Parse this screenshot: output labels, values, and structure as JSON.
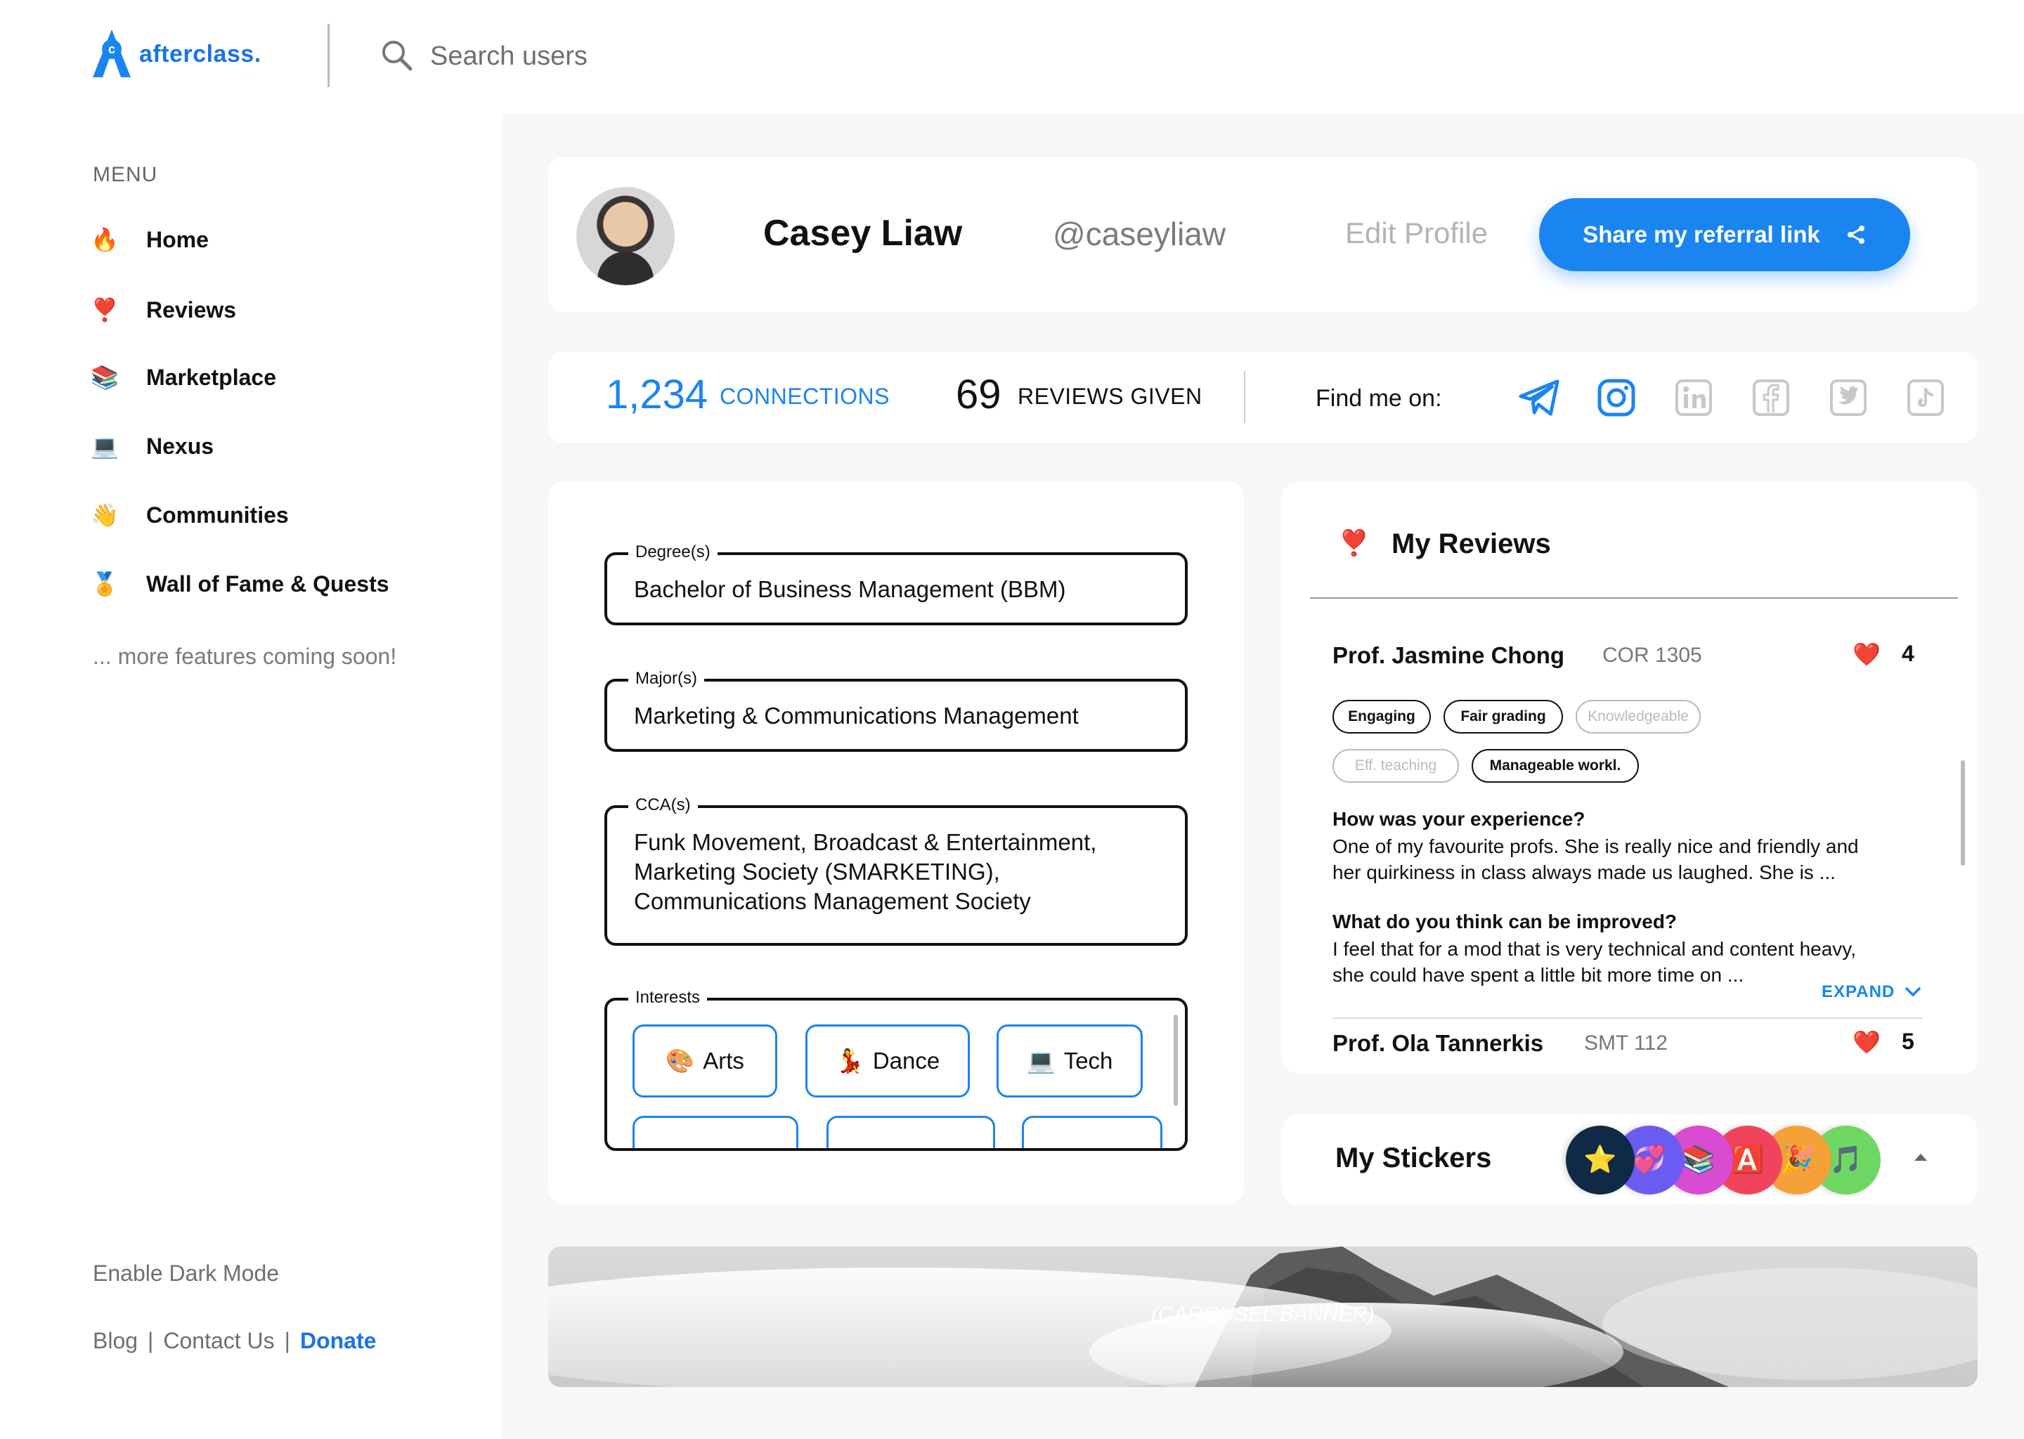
{
  "app": {
    "logo_text": "afterclass",
    "logo_dot": "."
  },
  "search": {
    "placeholder": "Search users"
  },
  "sidebar": {
    "menu_label": "MENU",
    "items": [
      {
        "emoji": "🔥",
        "label": "Home"
      },
      {
        "emoji": "❣️",
        "label": "Reviews"
      },
      {
        "emoji": "📚",
        "label": "Marketplace"
      },
      {
        "emoji": "💻",
        "label": "Nexus"
      },
      {
        "emoji": "👋",
        "label": "Communities"
      },
      {
        "emoji": "🏅",
        "label": "Wall of Fame & Quests"
      }
    ],
    "more_soon": "... more features coming soon!",
    "dark_mode": "Enable Dark Mode",
    "footer": {
      "blog": "Blog",
      "contact": "Contact Us",
      "donate": "Donate",
      "separator": "|"
    }
  },
  "profile": {
    "name": "Casey Liaw",
    "handle": "@caseyliaw",
    "edit_label": "Edit Profile",
    "share_label": "Share my referral link"
  },
  "stats": {
    "connections_count": "1,234",
    "connections_label": "CONNECTIONS",
    "reviews_count": "69",
    "reviews_label": "REVIEWS GIVEN",
    "find_me": "Find me on:",
    "socials": [
      "telegram-icon",
      "instagram-icon",
      "linkedin-icon",
      "facebook-icon",
      "twitter-icon",
      "tiktok-icon"
    ],
    "accent": "#1a85f0"
  },
  "education": {
    "degree_label": "Degree(s)",
    "degree_value": "Bachelor of Business Management (BBM)",
    "major_label": "Major(s)",
    "major_value": "Marketing & Communications Management",
    "cca_label": "CCA(s)",
    "cca_lines": [
      "Funk Movement, Broadcast & Entertainment,",
      "Marketing Society (SMARKETING),",
      "Communications Management Society"
    ],
    "interests_label": "Interests",
    "interests": [
      {
        "emoji": "🎨",
        "label": "Arts"
      },
      {
        "emoji": "💃",
        "label": "Dance"
      },
      {
        "emoji": "💻",
        "label": "Tech"
      }
    ]
  },
  "reviews": {
    "emoji": "❣️",
    "title": "My Reviews",
    "items": [
      {
        "prof": "Prof. Jasmine Chong",
        "code": "COR 1305",
        "hearts": "4",
        "tags_active": [
          "Engaging",
          "Fair grading",
          "Manageable workl."
        ],
        "tags_inactive": [
          "Knowledgeable",
          "Eff. teaching"
        ],
        "q1": "How was your experience?",
        "a1_lines": [
          "One of my favourite profs. She is really nice and friendly and",
          "her quirkiness in class always made us laughed. She is ..."
        ],
        "q2": "What do you think can be improved?",
        "a2_lines": [
          "I feel that for a mod that is very technical and content heavy,",
          "she could have spent a little bit more time on ..."
        ],
        "expand": "EXPAND"
      },
      {
        "prof": "Prof. Ola Tannerkis",
        "code": "SMT 112",
        "hearts": "5"
      }
    ]
  },
  "stickers": {
    "title": "My Stickers",
    "items": [
      {
        "emoji": "⭐",
        "bg": "#0f2a47"
      },
      {
        "emoji": "💞",
        "bg": "#6a5cf2"
      },
      {
        "emoji": "📚",
        "bg": "#d94bd0"
      },
      {
        "emoji": "🅰️",
        "bg": "#f0445c"
      },
      {
        "emoji": "🎉",
        "bg": "#f5a13a"
      },
      {
        "emoji": "🎵",
        "bg": "#6fd764"
      }
    ]
  },
  "banner": {
    "caption": "(CAROUSEL BANNER)"
  }
}
